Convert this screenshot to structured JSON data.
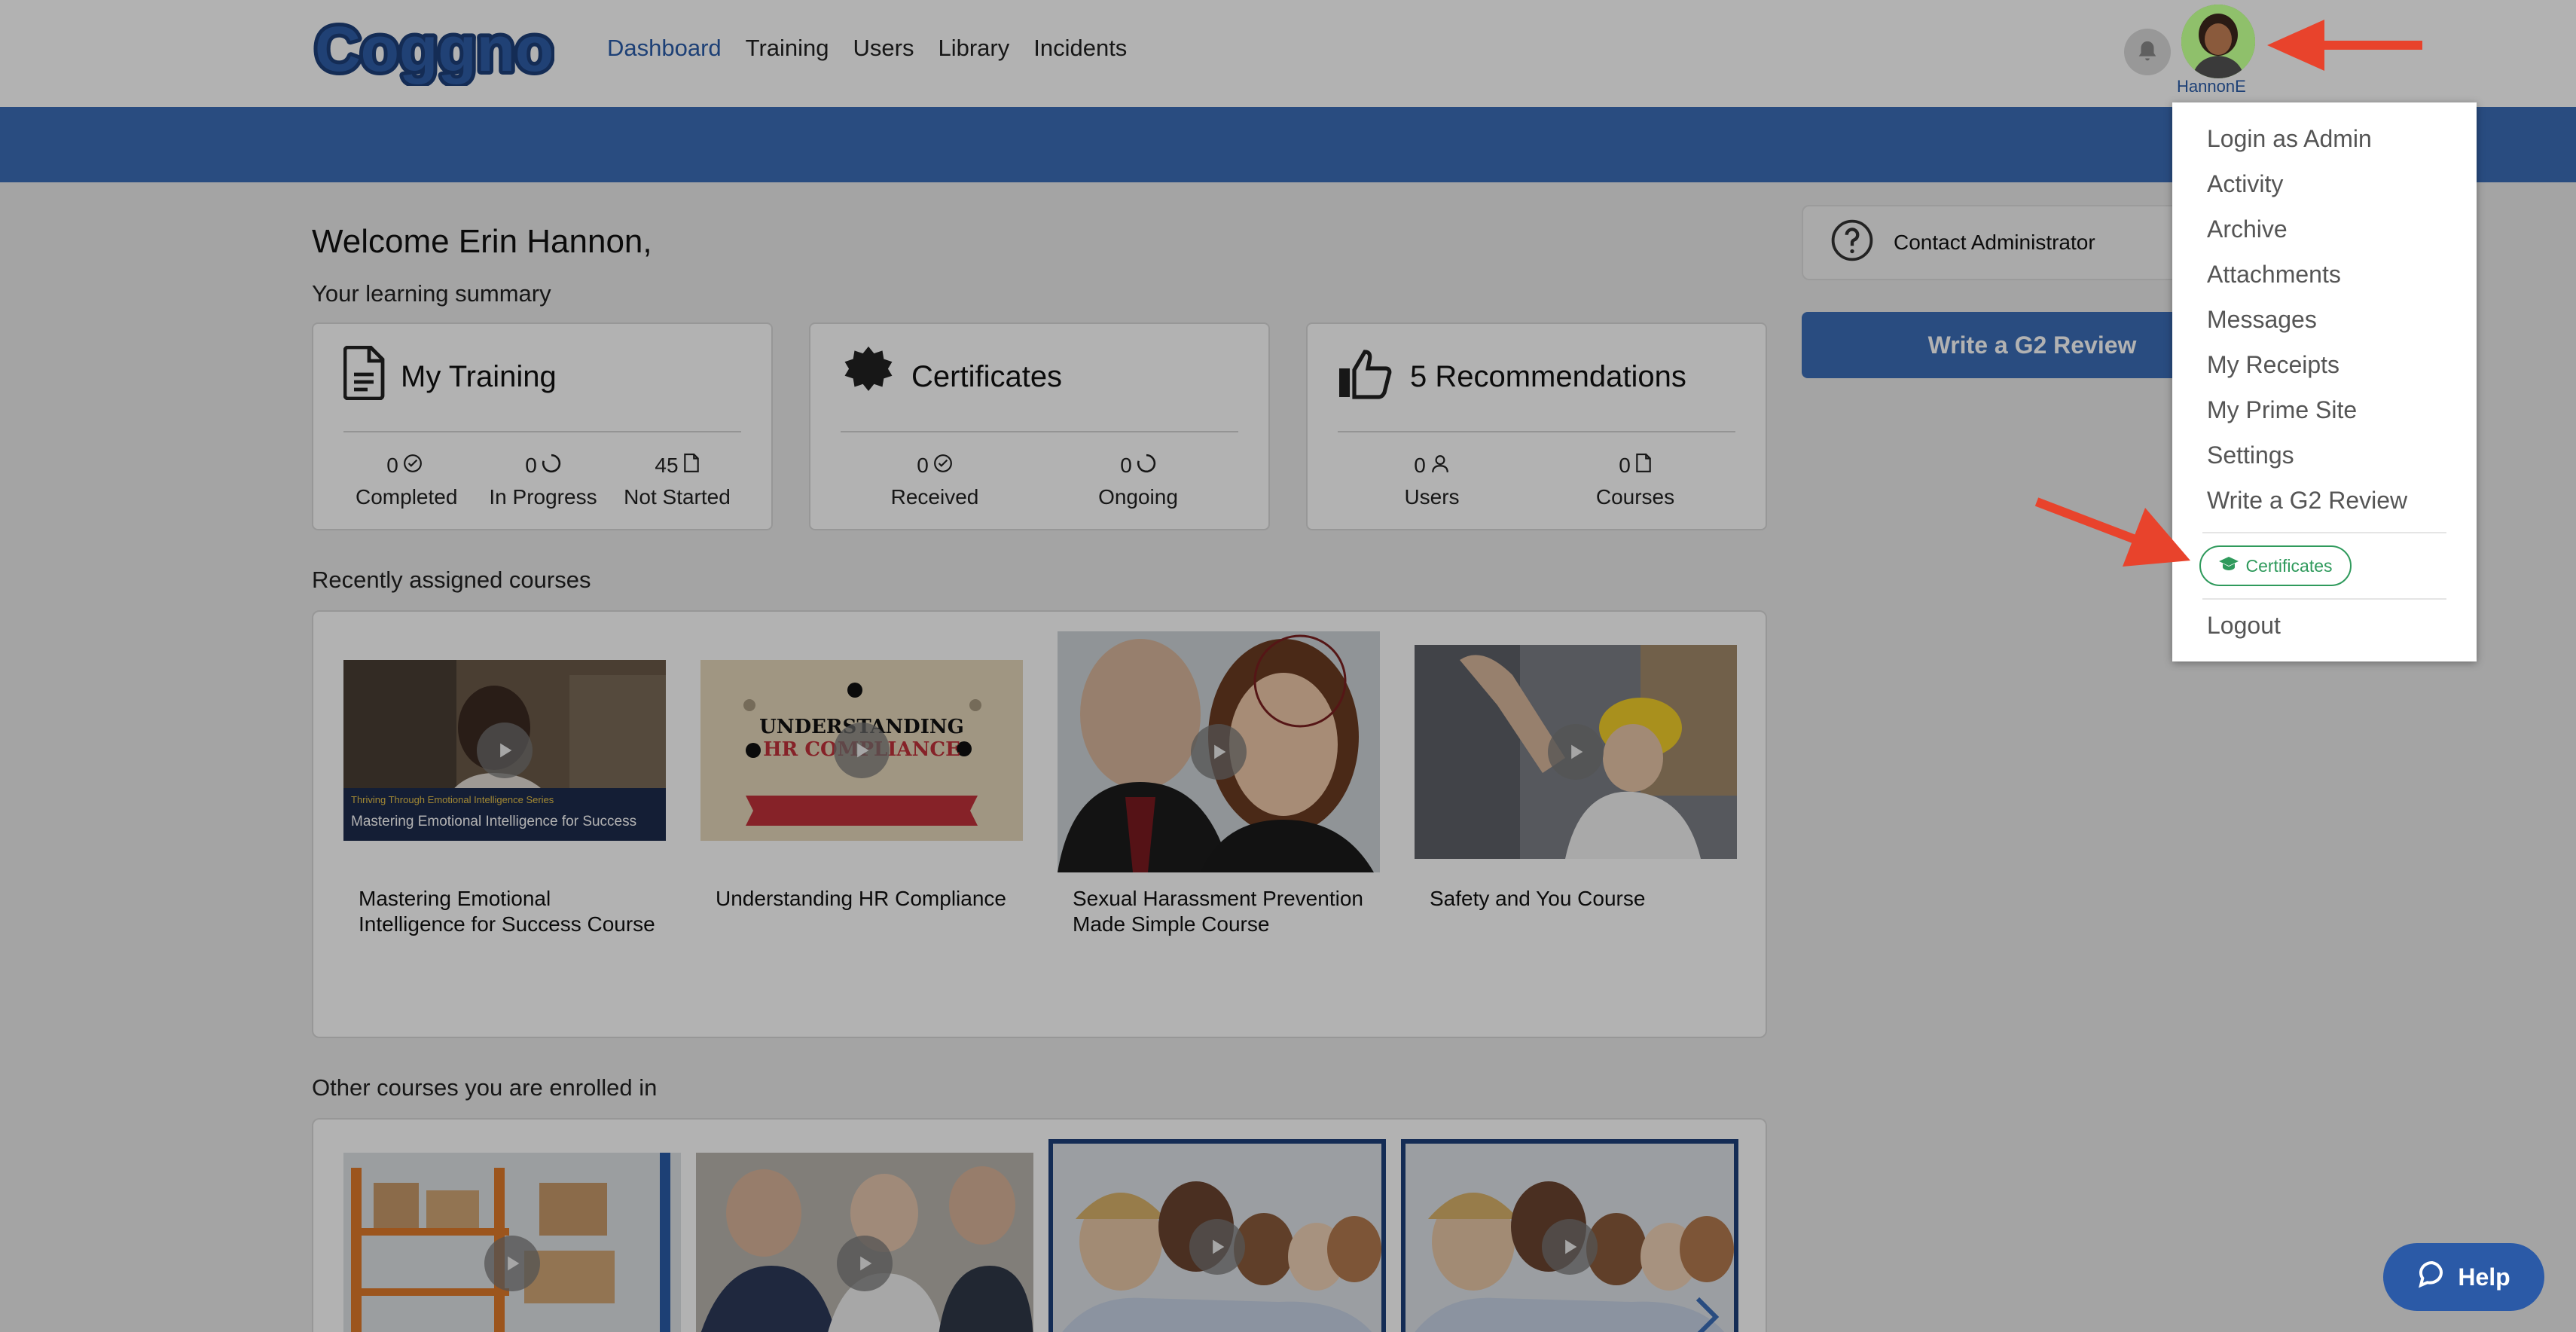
{
  "header": {
    "logo_text": "Coggno",
    "nav": [
      {
        "label": "Dashboard",
        "active": true
      },
      {
        "label": "Training"
      },
      {
        "label": "Users"
      },
      {
        "label": "Library"
      },
      {
        "label": "Incidents"
      }
    ],
    "username": "HannonE"
  },
  "main": {
    "welcome": "Welcome Erin Hannon,",
    "summary": "Your learning summary",
    "cards": [
      {
        "title": "My Training",
        "icon": "document-icon",
        "stats": [
          {
            "value": "0",
            "icon": "check-circle-icon",
            "label": "Completed"
          },
          {
            "value": "0",
            "icon": "progress-circle-icon",
            "label": "In Progress"
          },
          {
            "value": "45",
            "icon": "file-icon",
            "label": "Not Started"
          }
        ]
      },
      {
        "title": "Certificates",
        "icon": "badge-icon",
        "stats": [
          {
            "value": "0",
            "icon": "check-circle-icon",
            "label": "Received"
          },
          {
            "value": "0",
            "icon": "progress-circle-icon",
            "label": "Ongoing"
          }
        ]
      },
      {
        "title": "5 Recommendations",
        "icon": "thumbs-up-icon",
        "stats": [
          {
            "value": "0",
            "icon": "user-icon",
            "label": "Users"
          },
          {
            "value": "0",
            "icon": "file-icon",
            "label": "Courses"
          }
        ]
      }
    ],
    "recent_title": "Recently assigned courses",
    "recent_courses": [
      {
        "title": "Mastering Emotional Intelligence for Success Course",
        "thumb_caption_series": "Thriving Through Emotional Intelligence Series",
        "thumb_caption": "Mastering Emotional Intelligence for Success"
      },
      {
        "title": "Understanding HR Compliance",
        "thumb_line1": "UNDERSTANDING",
        "thumb_line2": "HR COMPLIANCE"
      },
      {
        "title": "Sexual Harassment Prevention Made Simple Course"
      },
      {
        "title": "Safety and You Course"
      }
    ],
    "other_title": "Other courses you are enrolled in"
  },
  "sidebar": {
    "contact_label": "Contact Administrator",
    "g2_button": "Write a G2 Review"
  },
  "dropdown": {
    "items": [
      "Login as Admin",
      "Activity",
      "Archive",
      "Attachments",
      "Messages",
      "My Receipts",
      "My Prime Site",
      "Settings",
      "Write a G2 Review"
    ],
    "certificates_label": "Certificates",
    "logout_label": "Logout"
  },
  "help_label": "Help",
  "colors": {
    "brand_blue": "#3b6eb8",
    "link_blue": "#2a5caa",
    "cert_green": "#2f9a5c",
    "arrow_red": "#e8432c"
  }
}
